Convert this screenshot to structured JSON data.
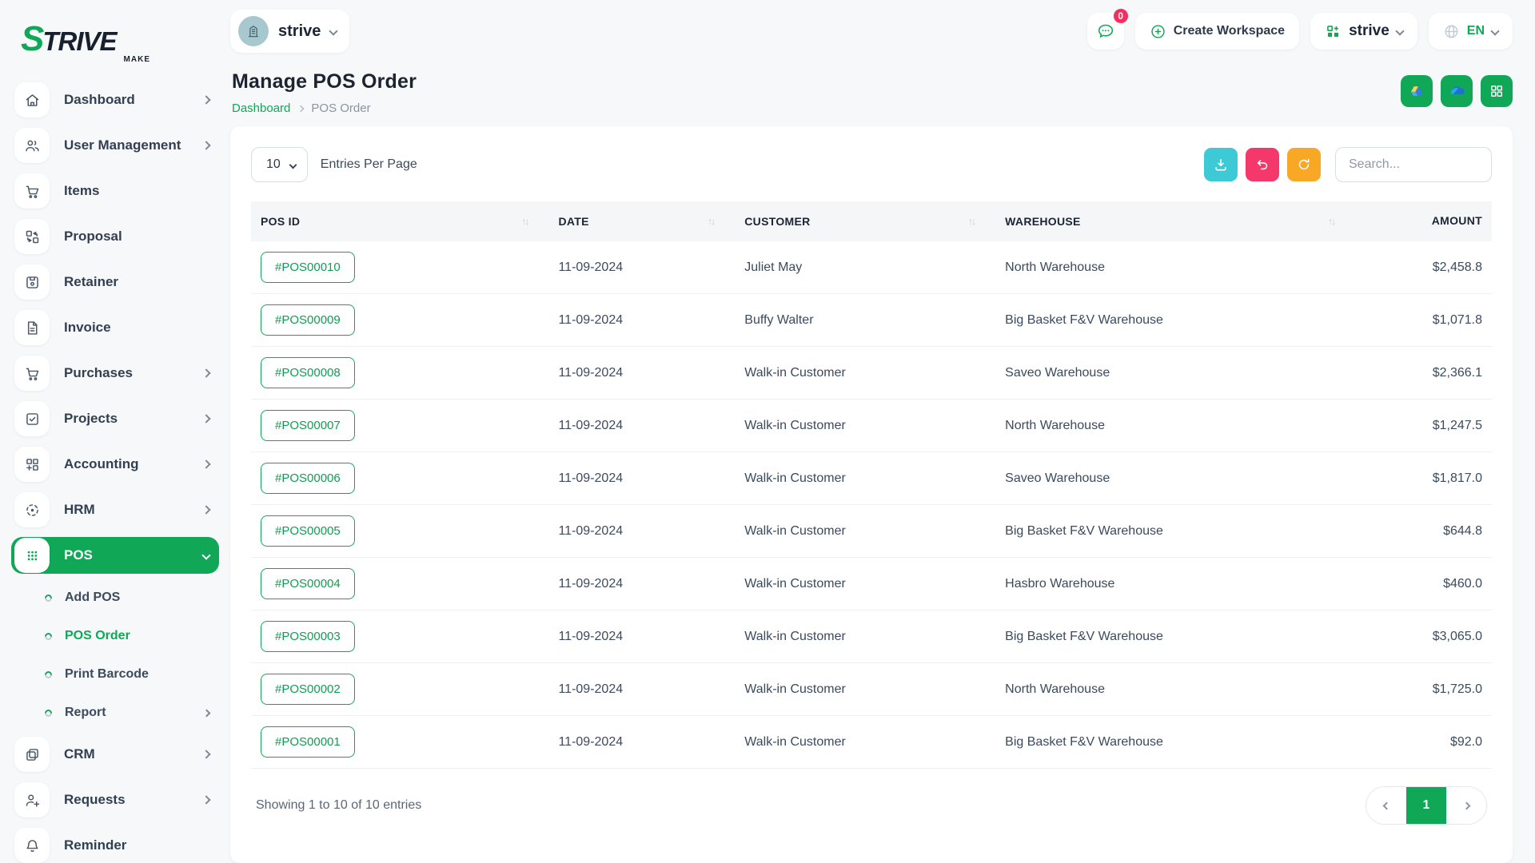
{
  "brand": {
    "logo_text_s": "S",
    "logo_text_rest": "TRIVE",
    "logo_sub": "MAKE"
  },
  "header": {
    "workspace_name": "strive",
    "messages_count": "0",
    "create_workspace_label": "Create Workspace",
    "app_switcher_label": "strive",
    "language": "EN"
  },
  "sidebar": {
    "items": [
      {
        "label": "Dashboard",
        "icon": "home-icon",
        "expandable": true
      },
      {
        "label": "User Management",
        "icon": "users-icon",
        "expandable": true
      },
      {
        "label": "Items",
        "icon": "cart-icon",
        "expandable": false
      },
      {
        "label": "Proposal",
        "icon": "swap-boxes-icon",
        "expandable": false
      },
      {
        "label": "Retainer",
        "icon": "floppy-icon",
        "expandable": false
      },
      {
        "label": "Invoice",
        "icon": "document-icon",
        "expandable": false
      },
      {
        "label": "Purchases",
        "icon": "cart-icon",
        "expandable": true
      },
      {
        "label": "Projects",
        "icon": "check-square-icon",
        "expandable": true
      },
      {
        "label": "Accounting",
        "icon": "grid-plus-icon",
        "expandable": true
      },
      {
        "label": "HRM",
        "icon": "scan-target-icon",
        "expandable": true
      },
      {
        "label": "POS",
        "icon": "grid-dots-icon",
        "expandable": true,
        "active": true
      }
    ],
    "pos_submenu": [
      {
        "label": "Add POS",
        "active": false
      },
      {
        "label": "POS Order",
        "active": true
      },
      {
        "label": "Print Barcode",
        "active": false
      },
      {
        "label": "Report",
        "active": false,
        "expandable": true
      }
    ],
    "items_bottom": [
      {
        "label": "CRM",
        "icon": "windows-icon",
        "expandable": true
      },
      {
        "label": "Requests",
        "icon": "user-plus-icon",
        "expandable": true
      },
      {
        "label": "Reminder",
        "icon": "bell-icon",
        "expandable": false
      }
    ]
  },
  "page": {
    "title": "Manage POS Order",
    "breadcrumb_home": "Dashboard",
    "breadcrumb_current": "POS Order",
    "quick_actions": [
      "google-drive-icon",
      "onedrive-icon",
      "grid-icon"
    ]
  },
  "toolbar": {
    "entries_per_page_value": "10",
    "entries_per_page_label": "Entries Per Page",
    "search_placeholder": "Search...",
    "actions": [
      "download-icon",
      "undo-icon",
      "refresh-icon"
    ]
  },
  "table": {
    "columns": {
      "pos_id": "POS ID",
      "date": "DATE",
      "customer": "CUSTOMER",
      "warehouse": "WAREHOUSE",
      "amount": "AMOUNT"
    },
    "rows": [
      {
        "pos_id": "#POS00010",
        "date": "11-09-2024",
        "customer": "Juliet May",
        "warehouse": "North Warehouse",
        "amount": "$2,458.8"
      },
      {
        "pos_id": "#POS00009",
        "date": "11-09-2024",
        "customer": "Buffy Walter",
        "warehouse": "Big Basket F&V Warehouse",
        "amount": "$1,071.8"
      },
      {
        "pos_id": "#POS00008",
        "date": "11-09-2024",
        "customer": "Walk-in Customer",
        "warehouse": "Saveo Warehouse",
        "amount": "$2,366.1"
      },
      {
        "pos_id": "#POS00007",
        "date": "11-09-2024",
        "customer": "Walk-in Customer",
        "warehouse": "North Warehouse",
        "amount": "$1,247.5"
      },
      {
        "pos_id": "#POS00006",
        "date": "11-09-2024",
        "customer": "Walk-in Customer",
        "warehouse": "Saveo Warehouse",
        "amount": "$1,817.0"
      },
      {
        "pos_id": "#POS00005",
        "date": "11-09-2024",
        "customer": "Walk-in Customer",
        "warehouse": "Big Basket F&V Warehouse",
        "amount": "$644.8"
      },
      {
        "pos_id": "#POS00004",
        "date": "11-09-2024",
        "customer": "Walk-in Customer",
        "warehouse": "Hasbro Warehouse",
        "amount": "$460.0"
      },
      {
        "pos_id": "#POS00003",
        "date": "11-09-2024",
        "customer": "Walk-in Customer",
        "warehouse": "Big Basket F&V Warehouse",
        "amount": "$3,065.0"
      },
      {
        "pos_id": "#POS00002",
        "date": "11-09-2024",
        "customer": "Walk-in Customer",
        "warehouse": "North Warehouse",
        "amount": "$1,725.0"
      },
      {
        "pos_id": "#POS00001",
        "date": "11-09-2024",
        "customer": "Walk-in Customer",
        "warehouse": "Big Basket F&V Warehouse",
        "amount": "$92.0"
      }
    ],
    "footer": {
      "showing_text": "Showing 1 to 10 of 10 entries",
      "current_page": "1"
    }
  },
  "colors": {
    "primary_green": "#10a857",
    "teal_button": "#3ec9d6",
    "pink_button": "#f4386c",
    "orange_button": "#f9a825",
    "badge_red": "#f62e5e"
  }
}
